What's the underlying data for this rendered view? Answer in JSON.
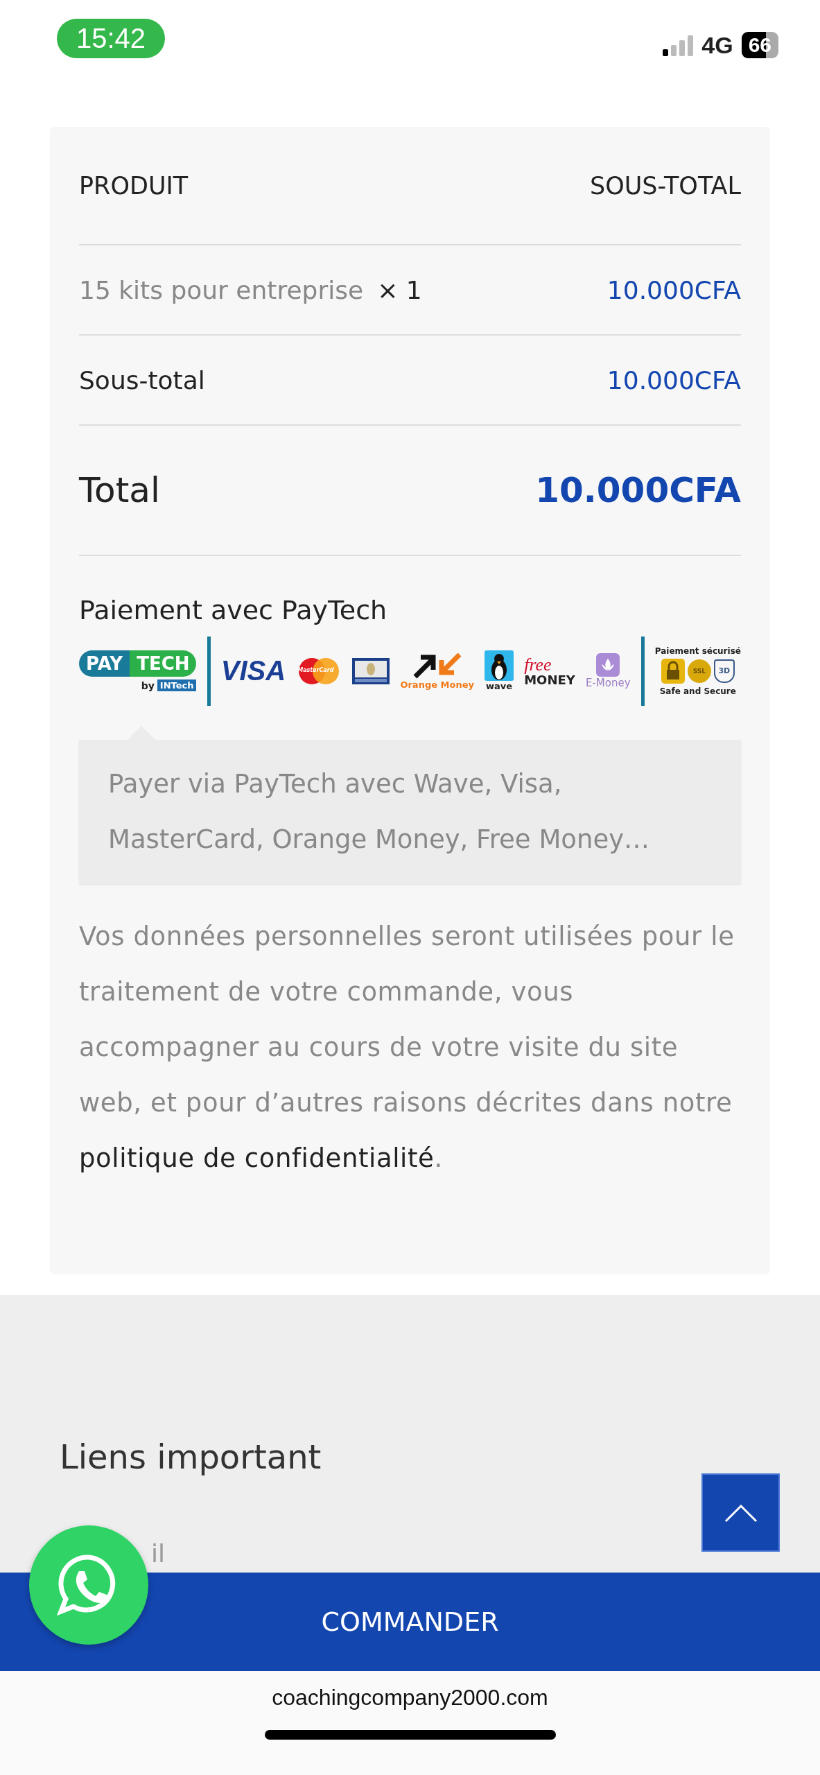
{
  "status_bar": {
    "time": "15:42",
    "network": "4G",
    "battery": "66"
  },
  "order_table": {
    "columns": [
      "PRODUIT",
      "SOUS-TOTAL"
    ],
    "items": [
      {
        "product": "15 kits pour entreprise",
        "quantity": "× 1",
        "subtotal": "10.000CFA"
      }
    ],
    "subtotal": {
      "label": "Sous-total",
      "value": "10.000CFA"
    },
    "total": {
      "label": "Total",
      "value": "10.000CFA"
    }
  },
  "payment": {
    "title": "Paiement avec PayTech",
    "logos": [
      {
        "kind": "paytech",
        "parts": [
          "PAY",
          "TECH"
        ],
        "byline": "by",
        "brand": "INTech"
      },
      {
        "kind": "visa",
        "label": "VISA"
      },
      {
        "kind": "mastercard",
        "label": "MasterCard"
      },
      {
        "kind": "gim"
      },
      {
        "kind": "orange_money",
        "label": "Orange Money"
      },
      {
        "kind": "wave",
        "label": "wave"
      },
      {
        "kind": "free_money",
        "top": "free",
        "bottom": "MONEY"
      },
      {
        "kind": "emoney",
        "label": "E-Money"
      }
    ],
    "security": {
      "title": "Paiement sécurisé",
      "ssl": "SSL",
      "shield": "3D",
      "caption": "Safe and Secure"
    },
    "description": "Payer via PayTech avec Wave, Visa, MasterCard, Orange Money, Free Money…"
  },
  "privacy": {
    "text": "Vos données personnelles seront utilisées pour le traitement de votre commande, vous accompagner au cours de votre visite du site web, et pour d’autres raisons décrites dans notre",
    "link": "politique de confidentialité",
    "end": "."
  },
  "footer": {
    "heading": "Liens important",
    "link_fragment": "il"
  },
  "order_button": "COMMANDER",
  "url": "coachingcompany2000.com"
}
